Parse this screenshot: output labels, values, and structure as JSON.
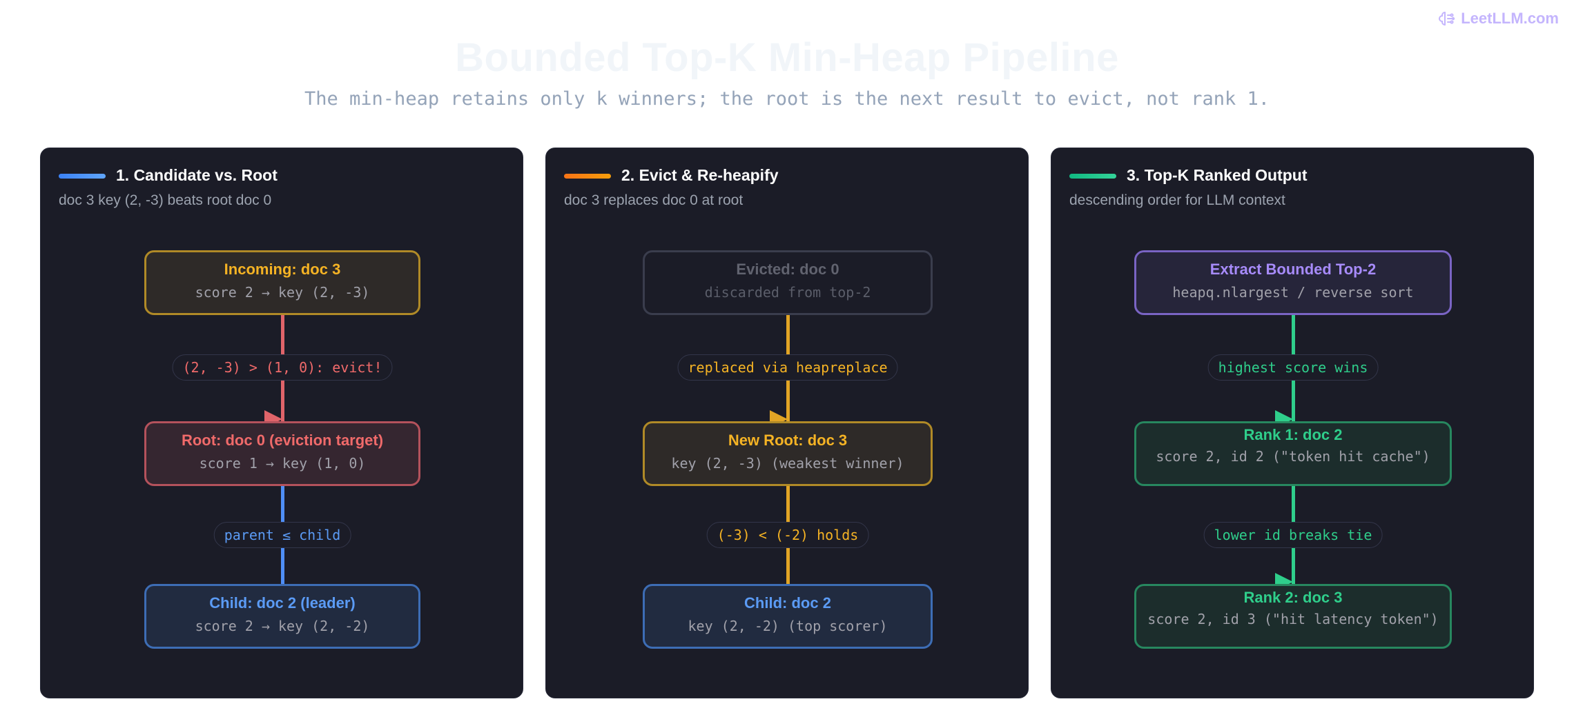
{
  "brand": {
    "name": "LeetLLM.com",
    "icon": "brain-circuit-icon"
  },
  "header": {
    "title": "Bounded Top-K Min-Heap Pipeline",
    "subtitle": "The min-heap retains only k winners; the root is the next result to evict, not rank 1."
  },
  "colors": {
    "page_background": "#ffffff",
    "panel_background": "#1b1c27",
    "blue": "#4f8ef7",
    "red": "#f06a6a",
    "orange": "#f5b324",
    "green": "#2fce8b",
    "purple": "#a78bfa",
    "gray": "#6b7280"
  },
  "panels": [
    {
      "title": "1. Candidate vs. Root",
      "description": "doc 3 key (2, -3) beats root doc 0",
      "accent": [
        "#3b82f6",
        "#60a5fa"
      ],
      "nodes": [
        {
          "title": "Incoming: doc 3",
          "sub": "score 2 → key (2, -3)",
          "style": "orange"
        },
        {
          "title": "Root: doc 0 (eviction target)",
          "sub": "score 1 → key (1, 0)",
          "style": "red"
        },
        {
          "title": "Child: doc 2 (leader)",
          "sub": "score 2 → key (2, -2)",
          "style": "blue"
        }
      ],
      "edges": [
        {
          "label": "(2, -3) > (1, 0): evict!",
          "color": "red",
          "arrow": true
        },
        {
          "label": "parent ≤ child",
          "color": "blue",
          "arrow": false
        }
      ]
    },
    {
      "title": "2. Evict & Re-heapify",
      "description": "doc 3 replaces doc 0 at root",
      "accent": [
        "#f97316",
        "#f59e0b"
      ],
      "nodes": [
        {
          "title": "Evicted: doc 0",
          "sub": "discarded from top-2",
          "style": "gray"
        },
        {
          "title": "New Root: doc 3",
          "sub": "key (2, -3) (weakest winner)",
          "style": "orange"
        },
        {
          "title": "Child: doc 2",
          "sub": "key (2, -2) (top scorer)",
          "style": "blue"
        }
      ],
      "edges": [
        {
          "label": "replaced via heapreplace",
          "color": "orange",
          "arrow": true
        },
        {
          "label": "(-3) < (-2) holds",
          "color": "orange",
          "arrow": false
        }
      ]
    },
    {
      "title": "3. Top-K Ranked Output",
      "description": "descending order for LLM context",
      "accent": [
        "#10b981",
        "#34d399"
      ],
      "nodes": [
        {
          "title": "Extract Bounded Top-2",
          "sub": "heapq.nlargest / reverse sort",
          "style": "purple"
        },
        {
          "title": "Rank 1: doc 2",
          "sub": "score 2, id 2 (\"token hit cache\")",
          "style": "green"
        },
        {
          "title": "Rank 2: doc 3",
          "sub": "score 2, id 3 (\"hit latency token\")",
          "style": "green"
        }
      ],
      "edges": [
        {
          "label": "highest score wins",
          "color": "green",
          "arrow": true
        },
        {
          "label": "lower id breaks tie",
          "color": "green",
          "arrow": true
        }
      ]
    }
  ]
}
